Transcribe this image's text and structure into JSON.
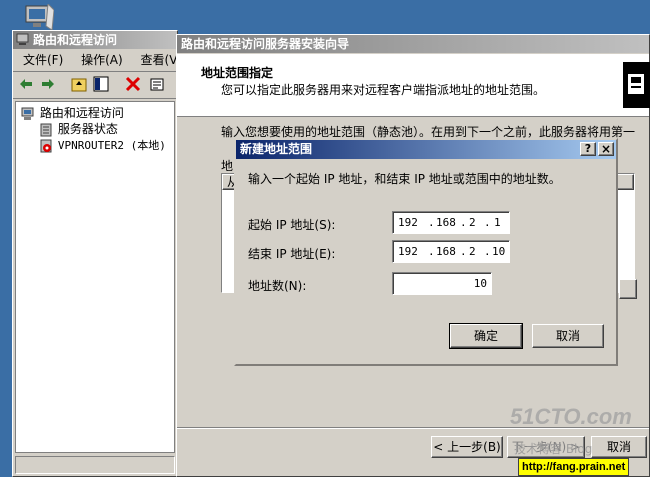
{
  "mmc": {
    "title": "路由和远程访问",
    "menu": [
      "文件(F)",
      "操作(A)",
      "查看(V)"
    ],
    "tree": {
      "root": "路由和远程访问",
      "children": [
        "服务器状态",
        "VPNROUTER2 (本地)"
      ]
    }
  },
  "wizard": {
    "title": "路由和远程访问服务器安装向导",
    "heading": "地址范围指定",
    "subheading": "您可以指定此服务器用来对远程客户端指派地址的地址范围。",
    "body_text": "输入您想要使用的地址范围（静态池）。在用到下一个之前，此服务器将用第一",
    "list_label": "地",
    "list_header": "从",
    "back_button": "< 上一步(B)",
    "next_button": "下一步(N) >",
    "cancel_button": "取消"
  },
  "dialog": {
    "title": "新建地址范围",
    "help_glyph": "?",
    "close_glyph": "×",
    "instruction": "输入一个起始 IP 地址，和结束 IP 地址或范围中的地址数。",
    "start_label": "起始 IP 地址(S):",
    "start_ip": [
      "192",
      "168",
      "2",
      "1"
    ],
    "end_label": "结束 IP 地址(E):",
    "end_ip": [
      "192",
      "168",
      "2",
      "10"
    ],
    "count_label": "地址数(N):",
    "count_value": "10",
    "ok_button": "确定",
    "cancel_button": "取消"
  },
  "watermark": {
    "logo": "51CTO.com",
    "sub": "技术博客 Blog",
    "url": "http://fang.prain.net"
  },
  "colors": {
    "desktop": "#3a6ea5",
    "title_active": "#0a246a",
    "title_inactive": "#808080",
    "face": "#d4d0c8",
    "url_bg": "#ffff00"
  }
}
